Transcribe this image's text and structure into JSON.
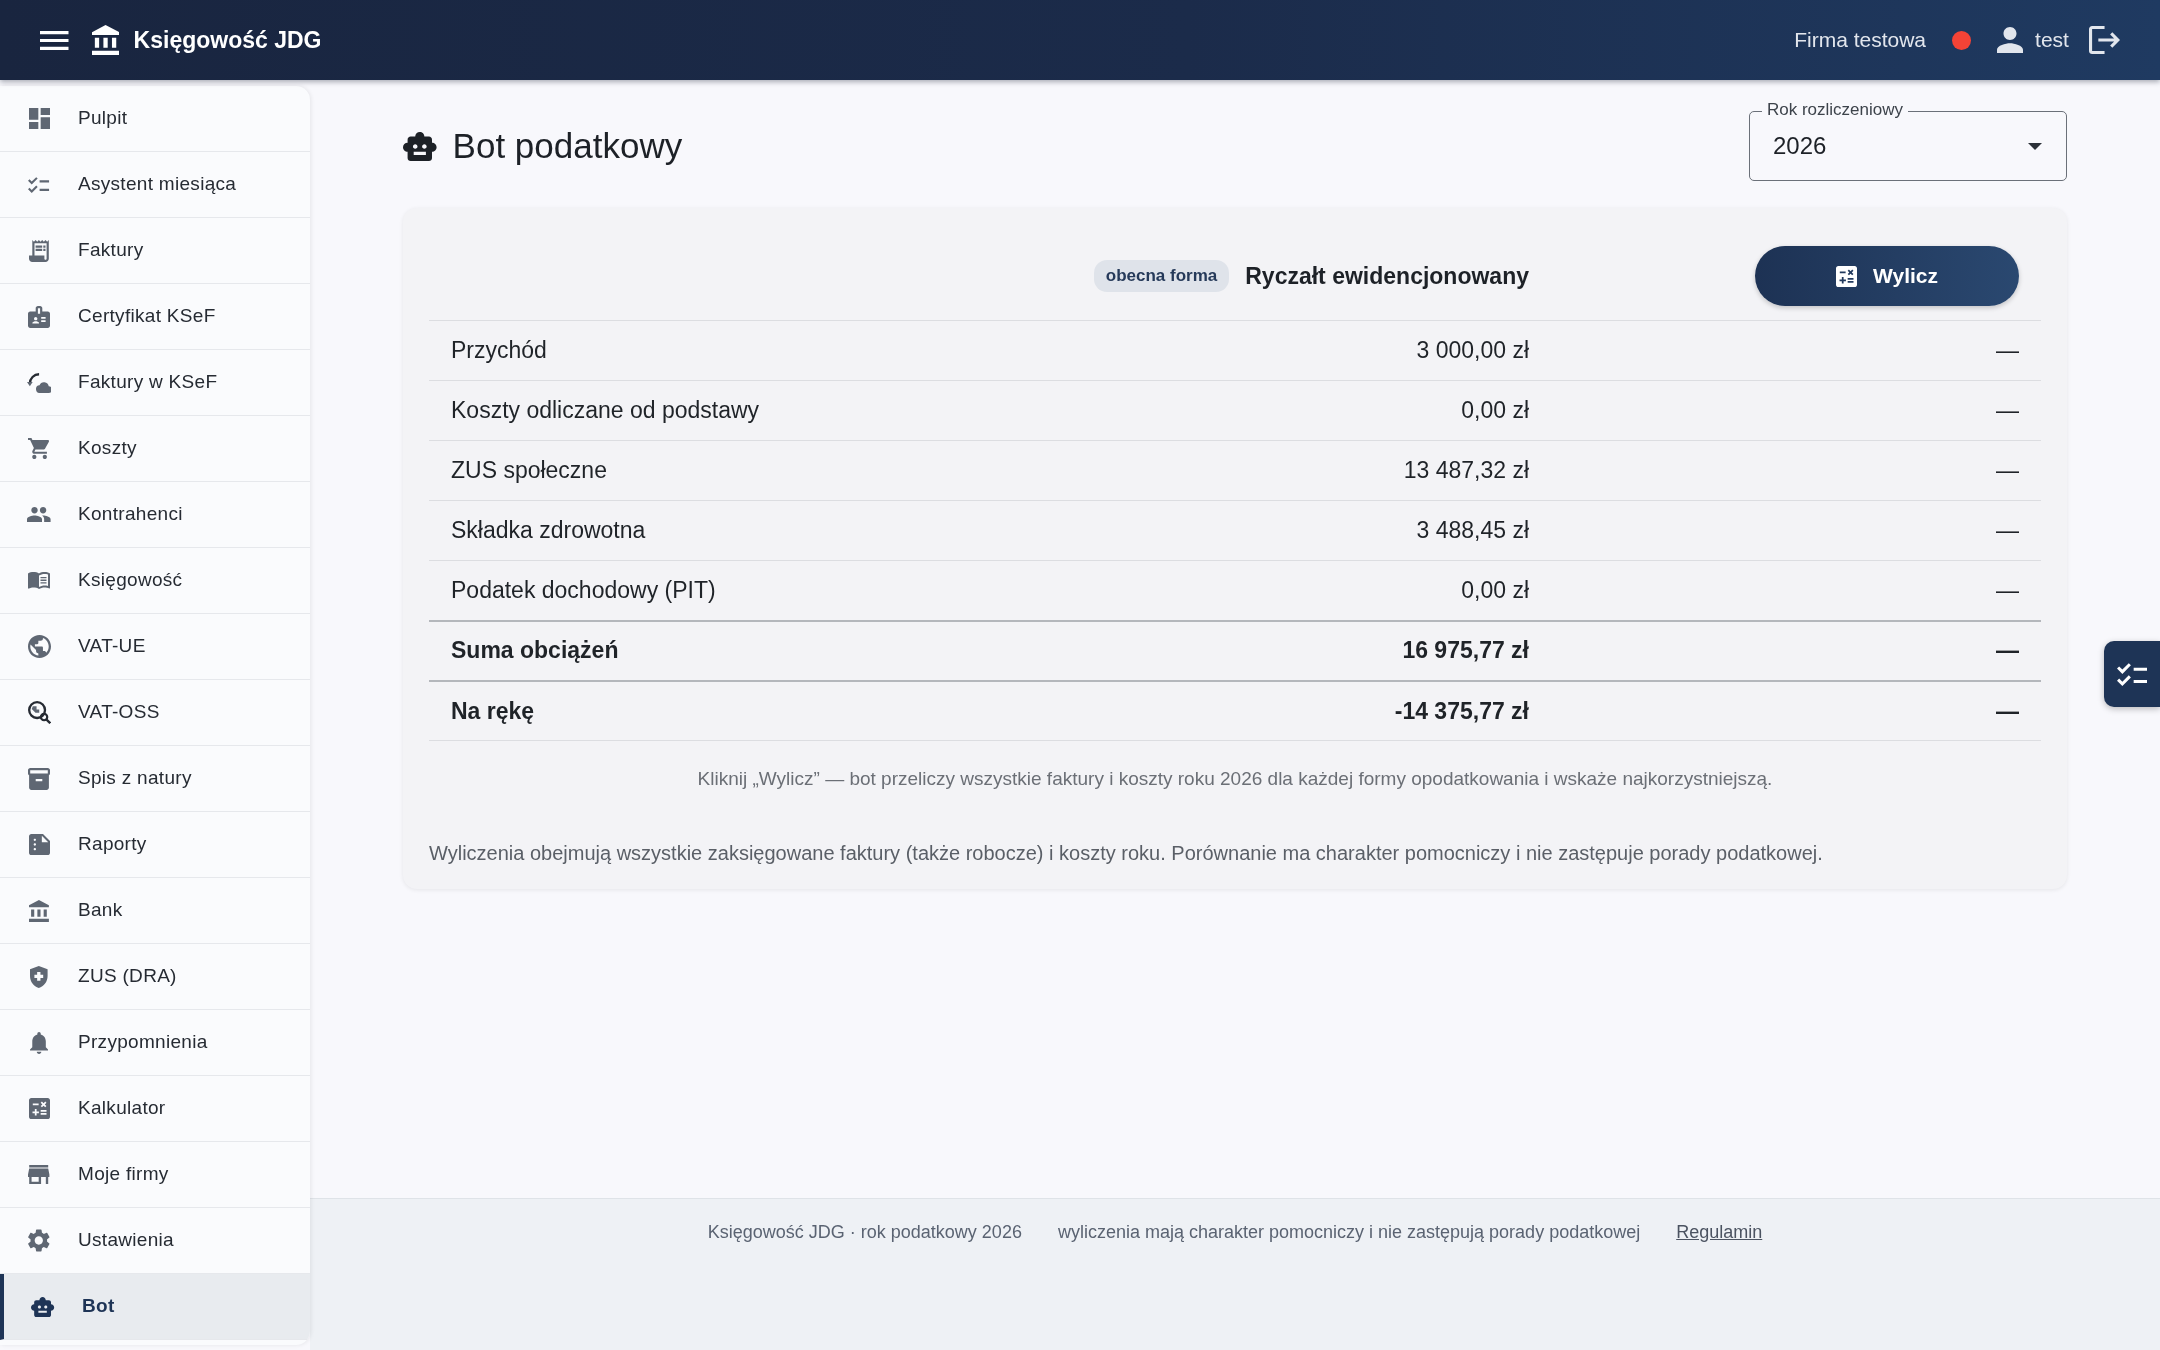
{
  "top_bar": {
    "app_title": "Księgowość JDG",
    "company": "Firma testowa",
    "user": "test"
  },
  "sidebar": {
    "items": [
      {
        "label": "Pulpit",
        "selected": false
      },
      {
        "label": "Asystent miesiąca",
        "selected": false
      },
      {
        "label": "Faktury",
        "selected": false
      },
      {
        "label": "Certyfikat KSeF",
        "selected": false
      },
      {
        "label": "Faktury w KSeF",
        "selected": false
      },
      {
        "label": "Koszty",
        "selected": false
      },
      {
        "label": "Kontrahenci",
        "selected": false
      },
      {
        "label": "Księgowość",
        "selected": false
      },
      {
        "label": "VAT-UE",
        "selected": false
      },
      {
        "label": "VAT-OSS",
        "selected": false
      },
      {
        "label": "Spis z natury",
        "selected": false
      },
      {
        "label": "Raporty",
        "selected": false
      },
      {
        "label": "Bank",
        "selected": false
      },
      {
        "label": "ZUS (DRA)",
        "selected": false
      },
      {
        "label": "Przypomnienia",
        "selected": false
      },
      {
        "label": "Kalkulator",
        "selected": false
      },
      {
        "label": "Moje firmy",
        "selected": false
      },
      {
        "label": "Ustawienia",
        "selected": false
      },
      {
        "label": "Bot",
        "selected": true
      }
    ]
  },
  "page": {
    "title": "Bot podatkowy",
    "year_select": {
      "label": "Rok rozliczeniowy",
      "value": "2026"
    }
  },
  "comparison": {
    "current_form_badge": "obecna forma",
    "form_name": "Ryczałt ewidencjonowany",
    "calculate_button": "Wylicz",
    "rows": [
      {
        "kind": "item",
        "label": "Przychód",
        "value": "3 000,00 zł",
        "column_3": "—"
      },
      {
        "kind": "item",
        "label": "Koszty odliczane od podstawy",
        "value": "0,00 zł",
        "column_3": "—"
      },
      {
        "kind": "item",
        "label": "ZUS społeczne",
        "value": "13 487,32 zł",
        "column_3": "—"
      },
      {
        "kind": "item",
        "label": "Składka zdrowotna",
        "value": "3 488,45 zł",
        "column_3": "—"
      },
      {
        "kind": "item",
        "label": "Podatek dochodowy (PIT)",
        "value": "0,00 zł",
        "column_3": "—"
      },
      {
        "kind": "total",
        "label": "Suma obciążeń",
        "value": "16 975,77 zł",
        "column_3": "—"
      },
      {
        "kind": "total",
        "label": "Na rękę",
        "value": "-14 375,77 zł",
        "column_3": "—"
      }
    ],
    "hint": "Kliknij „Wylicz” — bot przeliczy wszystkie faktury i koszty roku 2026 dla każdej formy opodatkowania i wskaże najkorzystniejszą.",
    "note": "Wyliczenia obejmują wszystkie zaksięgowane faktury (także robocze) i koszty roku. Porównanie ma charakter pomocniczy i nie zastępuje porady podatkowej."
  },
  "footer": {
    "texts": [
      "Księgowość JDG · rok podatkowy 2026",
      "wyliczenia mają charakter pomocniczy i nie zastępują porady podatkowej"
    ],
    "link": "Regulamin"
  }
}
